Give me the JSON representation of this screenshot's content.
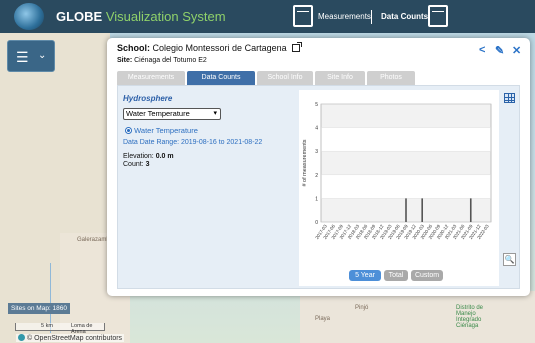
{
  "header": {
    "brand": "GLOBE",
    "title": "Visualization System",
    "measurements_label": "Measurements",
    "data_counts_label": "Data Counts"
  },
  "map": {
    "sites_on_map": "Sites on Map: 1860",
    "scale_left": "5 km",
    "scale_right": "Loma de Arena",
    "attribution": "© OpenStreetMap contributors",
    "labels": [
      "Galerazamba",
      "Pinjó",
      "Playa",
      "Distrito de Manejo Integrado Ciénaga"
    ]
  },
  "popup": {
    "school_label": "School:",
    "school_name": "Colegio Montessori de Cartagena",
    "site_label": "Site:",
    "site_name": "Ciénaga del Totumo E2",
    "tabs": [
      {
        "label": "Measurements",
        "active": false
      },
      {
        "label": "Data Counts",
        "active": true
      },
      {
        "label": "School Info",
        "active": false
      },
      {
        "label": "Site Info",
        "active": false
      },
      {
        "label": "Photos",
        "active": false
      }
    ],
    "section": "Hydrosphere",
    "selected_parameter": "Water Temperature",
    "radio_label": "Water Temperature",
    "date_range": "Data Date Range: 2019-08-16 to 2021-08-22",
    "elevation_label": "Elevation:",
    "elevation_value": "0.0 m",
    "count_label": "Count:",
    "count_value": "3",
    "range_buttons": [
      "5 Year",
      "Total",
      "Custom"
    ]
  },
  "chart_data": {
    "type": "bar",
    "ylabel": "# of measurements",
    "ylim": [
      0,
      5
    ],
    "yticks": [
      0,
      1,
      2,
      3,
      4,
      5
    ],
    "grid": true,
    "categories": [
      "2017-03",
      "2017-06",
      "2017-09",
      "2017-12",
      "2018-03",
      "2018-06",
      "2018-09",
      "2018-12",
      "2019-03",
      "2019-06",
      "2019-09",
      "2019-12",
      "2020-03",
      "2020-06",
      "2020-09",
      "2020-12",
      "2021-03",
      "2021-06",
      "2021-09",
      "2021-12",
      "2022-03"
    ],
    "values": [
      0,
      0,
      0,
      0,
      0,
      0,
      0,
      0,
      0,
      0,
      1,
      0,
      1,
      0,
      0,
      0,
      0,
      0,
      1,
      0,
      0
    ]
  }
}
